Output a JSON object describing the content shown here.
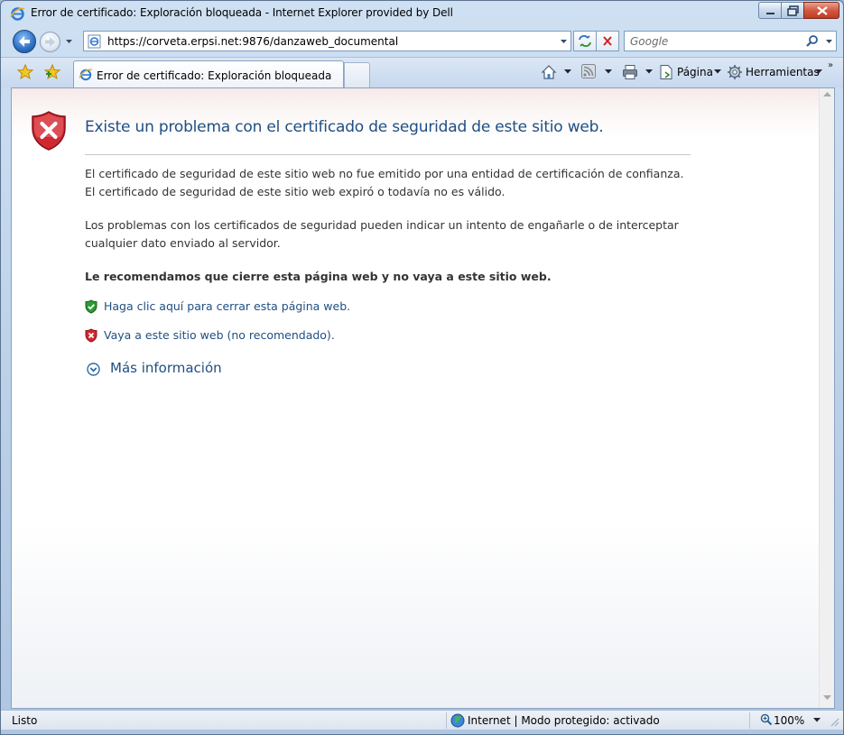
{
  "window": {
    "title": "Error de certificado: Exploración bloqueada - Internet Explorer provided by Dell"
  },
  "address_bar": {
    "url": "https://corveta.erpsi.net:9876/danzaweb_documental"
  },
  "search": {
    "placeholder": "Google"
  },
  "tabs": [
    {
      "label": "Error de certificado: Exploración bloqueada",
      "active": true
    }
  ],
  "command_bar": {
    "page_label": "Página",
    "tools_label": "Herramientas"
  },
  "content": {
    "heading": "Existe un problema con el certificado de seguridad de este sitio web.",
    "paragraph1_line1": "El certificado de seguridad de este sitio web no fue emitido por una entidad de certificación de confianza.",
    "paragraph1_line2": "El certificado de seguridad de este sitio web expiró o todavía no es válido.",
    "paragraph2_line1": "Los problemas con los certificados de seguridad pueden indicar un intento de engañarle o de interceptar",
    "paragraph2_line2": "cualquier dato enviado al servidor.",
    "recommendation": "Le recomendamos que cierre esta página web y no vaya a este sitio web.",
    "close_link": "Haga clic aquí para cerrar esta página web.",
    "continue_link": "Vaya a este sitio web (no recomendado).",
    "more_info": "Más información"
  },
  "status_bar": {
    "status": "Listo",
    "zone": "Internet | Modo protegido: activado",
    "zoom": "100%"
  },
  "colors": {
    "link": "#1f4f82",
    "danger": "#c8202a",
    "safe": "#2e8b2e"
  }
}
